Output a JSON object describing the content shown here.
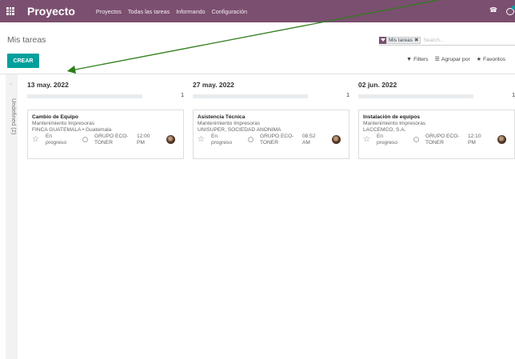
{
  "navbar": {
    "brand": "Proyecto",
    "menu": [
      "Proyectos",
      "Todas las tareas",
      "Informando",
      "Configuración"
    ],
    "color": "#7b4f70"
  },
  "control": {
    "breadcrumb": "Mis tareas",
    "create_label": "CREAR",
    "create_color": "#00a09d",
    "facet_label": "Mis tareas",
    "facet_remove": "✖",
    "search_placeholder": "Search...",
    "filters_label": "Filters",
    "groupby_label": "Agrupar por",
    "favorites_label": "Favoritos"
  },
  "kanban": {
    "folded_column": {
      "label": "Undefined (2)"
    },
    "columns": [
      {
        "title": "13 may. 2022",
        "count": "1",
        "card": {
          "title": "Cambio de Equipo",
          "project": "Mantenimiento Impresoras",
          "customer": "FINCA GUATEMALA • Guatemala",
          "stage": "En progreso",
          "partner": "GRUPO ECO-TONER",
          "time": "12:00 PM"
        }
      },
      {
        "title": "27 may. 2022",
        "count": "1",
        "card": {
          "title": "Asistencia Técnica",
          "project": "Mantenimiento Impresoras",
          "customer": "UNISUPER, SOCIEDAD ANONIMA",
          "stage": "En progreso",
          "partner": "GRUPO ECO-TONER",
          "time": "08:52 AM"
        }
      },
      {
        "title": "02 jun. 2022",
        "count": "1",
        "card": {
          "title": "Instalación de equipos",
          "project": "Mantenimiento Impresoras",
          "customer": "LACCEMCO, S.A.",
          "stage": "En progreso",
          "partner": "GRUPO ECO-TONER",
          "time": "12:10 PM"
        }
      }
    ]
  },
  "annotation": {
    "color": "#2e7d1a"
  }
}
